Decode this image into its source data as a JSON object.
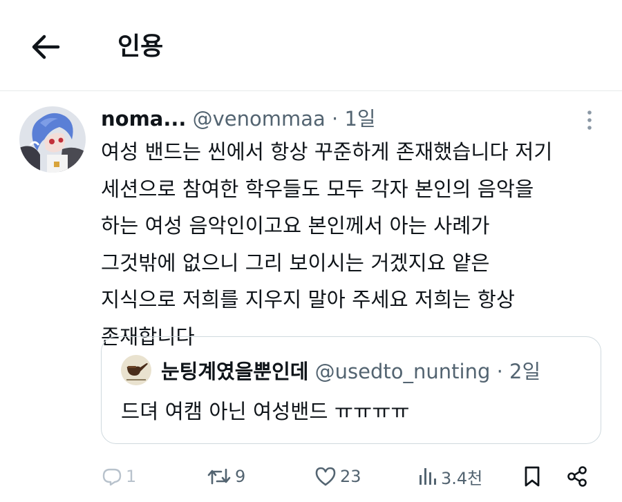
{
  "header": {
    "title": "인용"
  },
  "tweet": {
    "display_name": "noma...",
    "handle": "@venommaa",
    "separator": "·",
    "time": "1일",
    "lines": [
      "여성 밴드는 씬에서 항상 꾸준하게 존재했습니다 저기",
      "세션으로 참여한 학우들도 모두 각자 본인의 음악을",
      "하는 여성 음악인이고요 본인께서 아는 사례가",
      "그것밖에 없으니 그리 보이시는 거겠지요 얕은",
      "지식으로 저희를 지우지 말아 주세요 저희는 항상",
      "존재합니다"
    ]
  },
  "quoted": {
    "display_name": "눈팅계였을뿐인데",
    "handle": "@usedto_nunting",
    "separator": "·",
    "time": "2일",
    "text": "드뎌 여캠 아닌 여성밴드 ㅠㅠㅠㅠ"
  },
  "actions": {
    "replies": "1",
    "retweets": "9",
    "likes": "23",
    "views": "3.4천"
  },
  "colors": {
    "text_primary": "#0f1419",
    "text_secondary": "#536471",
    "border": "#cfd9de",
    "divider": "#e7e9ea"
  }
}
